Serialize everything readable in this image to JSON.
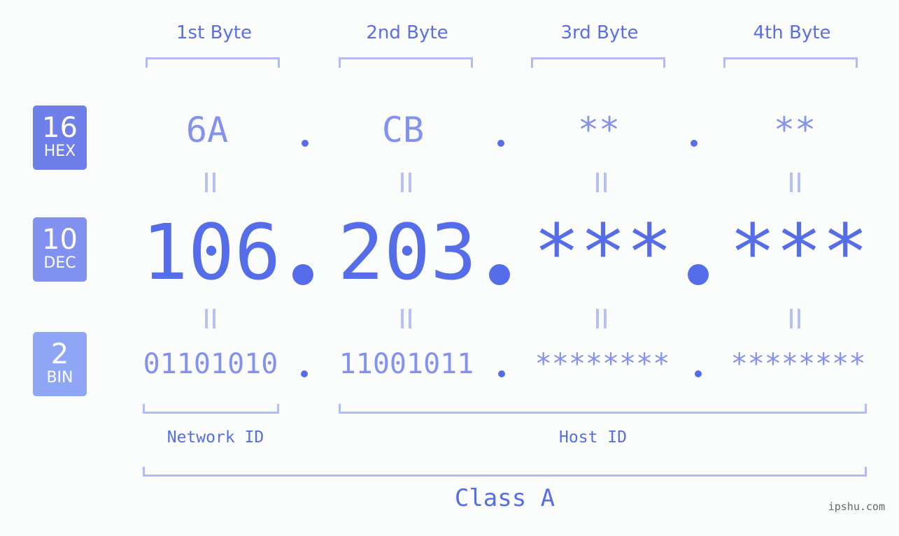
{
  "byte_headers": [
    "1st Byte",
    "2nd Byte",
    "3rd Byte",
    "4th Byte"
  ],
  "bases": [
    {
      "number": "16",
      "label": "HEX",
      "color": "#6e7fea"
    },
    {
      "number": "10",
      "label": "DEC",
      "color": "#8091f0"
    },
    {
      "number": "2",
      "label": "BIN",
      "color": "#8fa6f6"
    }
  ],
  "hex": [
    "6A",
    "CB",
    "**",
    "**"
  ],
  "dec": [
    "106",
    "203",
    "***",
    "***"
  ],
  "bin": [
    "01101010",
    "11001011",
    "********",
    "********"
  ],
  "network_label": "Network ID",
  "host_label": "Host ID",
  "class_label": "Class A",
  "watermark": "ipshu.com",
  "colors": {
    "accent": "#566de9",
    "light_accent": "#8391ef",
    "bracket": "#b1bbf7",
    "background": "#fbfdfc"
  }
}
